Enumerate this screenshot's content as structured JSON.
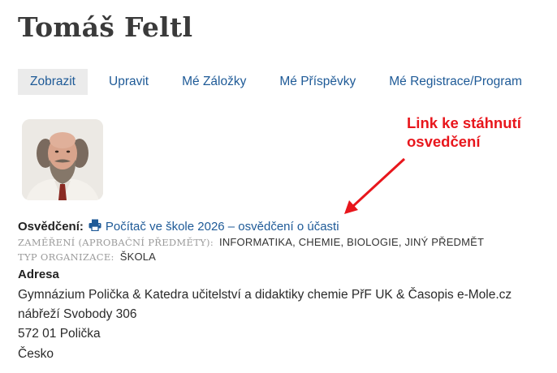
{
  "profile": {
    "name": "Tomáš Feltl"
  },
  "tabs": [
    {
      "label": "Zobrazit",
      "active": true
    },
    {
      "label": "Upravit",
      "active": false
    },
    {
      "label": "Mé Záložky",
      "active": false
    },
    {
      "label": "Mé Příspěvky",
      "active": false
    },
    {
      "label": "Mé Registrace/Program",
      "active": false
    }
  ],
  "annotation": {
    "line1": "Link ke stáhnutí",
    "line2": "osvedčení",
    "color": "#e8161c"
  },
  "certificate": {
    "label": "Osvědčení:",
    "icon": "print-icon",
    "link_text": "Počítač ve škole 2026 – osvědčení o účasti"
  },
  "fields": {
    "focus_key": "ZAMĚŘENÍ (APROBAČNÍ PŘEDMĚTY):",
    "focus_value": "INFORMATIKA, CHEMIE, BIOLOGIE, JINÝ PŘEDMĚT",
    "org_key": "TYP ORGANIZACE:",
    "org_value": "ŠKOLA"
  },
  "address": {
    "heading": "Adresa",
    "line1": "Gymnázium Polička & Katedra učitelství a didaktiky chemie PřF UK & Časopis e-Mole.cz",
    "line2": "nábřeží Svobody 306",
    "line3": "572 01 Polička",
    "line4": "Česko"
  },
  "colors": {
    "link": "#1e5a97",
    "active_tab_bg": "#ebebeb",
    "annotation": "#e8161c"
  }
}
